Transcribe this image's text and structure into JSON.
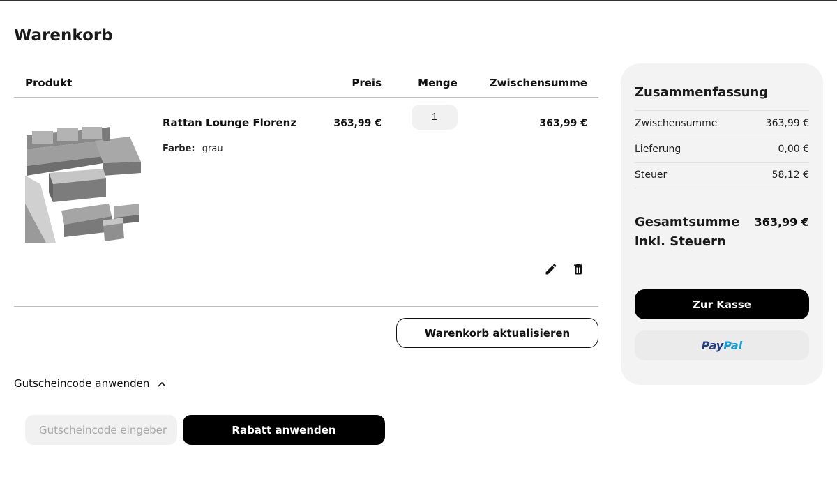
{
  "page": {
    "title": "Warenkorb"
  },
  "table": {
    "headers": {
      "product": "Produkt",
      "price": "Preis",
      "quantity": "Menge",
      "subtotal": "Zwischensumme"
    }
  },
  "item": {
    "name": "Rattan Lounge Florenz",
    "attribute_label": "Farbe:",
    "attribute_value": "grau",
    "price": "363,99 €",
    "quantity": "1",
    "subtotal": "363,99 €",
    "image_icon": "rattan-lounge-image"
  },
  "actions": {
    "update_cart": "Warenkorb aktualisieren",
    "edit_icon": "pencil-icon",
    "delete_icon": "trash-icon"
  },
  "coupon": {
    "toggle_label": "Gutscheincode anwenden",
    "toggle_icon": "chevron-up-icon",
    "placeholder": "Gutscheincode eingeber",
    "apply_label": "Rabatt anwenden"
  },
  "summary": {
    "title": "Zusammenfassung",
    "rows": [
      {
        "label": "Zwischensumme",
        "value": "363,99 €"
      },
      {
        "label": "Lieferung",
        "value": "0,00 €"
      },
      {
        "label": "Steuer",
        "value": "58,12 €"
      }
    ],
    "total_label": "Gesamtsumme inkl. Steuern",
    "total_value": "363,99 €",
    "checkout_label": "Zur Kasse",
    "paypal_part1": "Pay",
    "paypal_part2": "Pal"
  },
  "colors": {
    "accent": "#000000",
    "panel_bg": "#f3f3f3",
    "paypal_dark": "#253b80",
    "paypal_light": "#179bd7"
  }
}
